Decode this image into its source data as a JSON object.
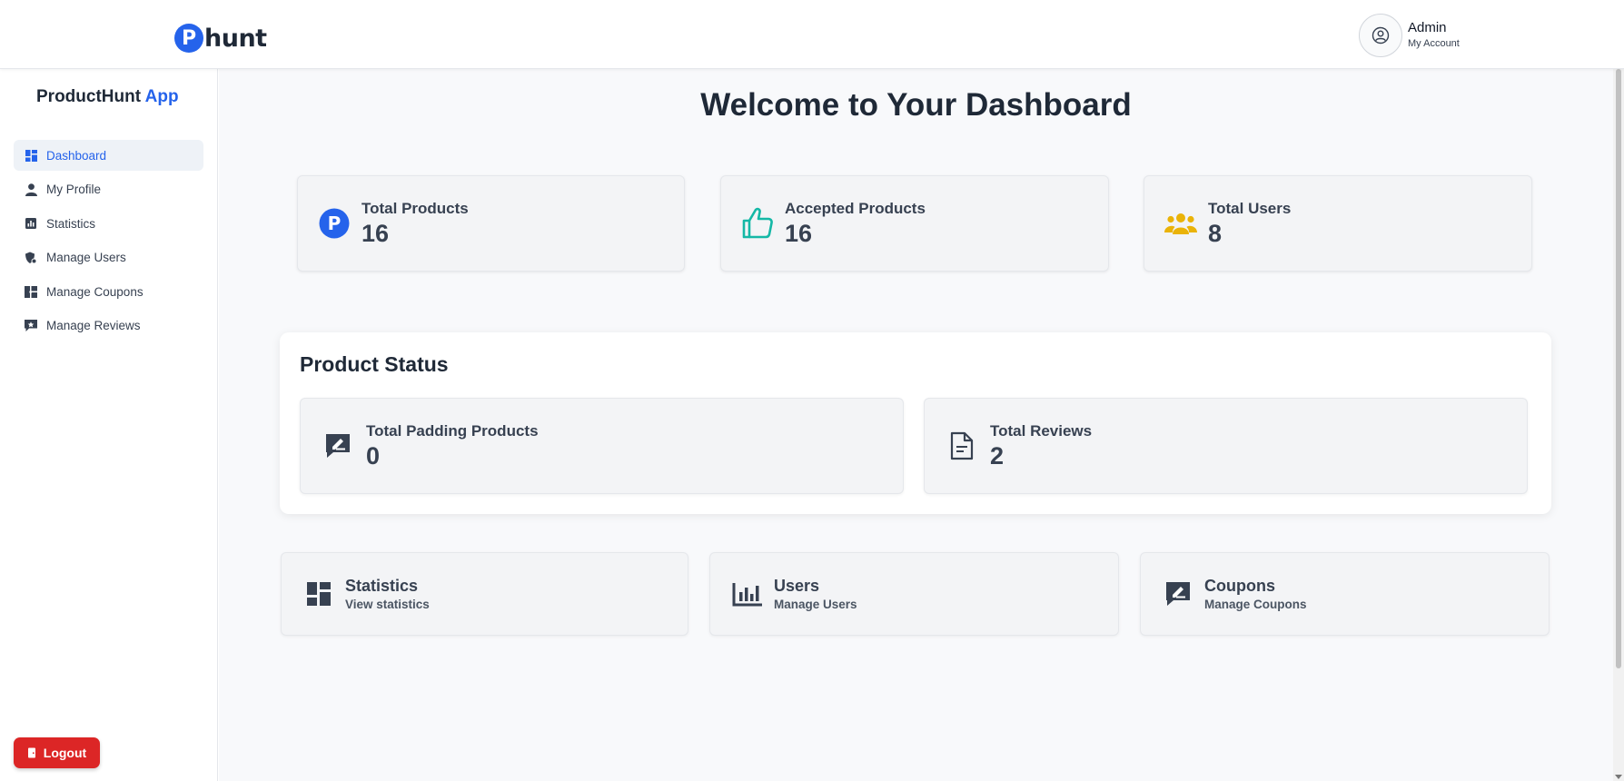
{
  "header": {
    "logo_letter": "P",
    "logo_text": "hunt",
    "account_name": "Admin",
    "account_sub": "My Account"
  },
  "sidebar": {
    "brand_main": "ProductHunt",
    "brand_accent": "App",
    "items": [
      {
        "label": "Dashboard",
        "icon": "dashboard-icon",
        "active": true
      },
      {
        "label": "My Profile",
        "icon": "user-icon",
        "active": false
      },
      {
        "label": "Statistics",
        "icon": "chart-icon",
        "active": false
      },
      {
        "label": "Manage Users",
        "icon": "user-gear-icon",
        "active": false
      },
      {
        "label": "Manage Coupons",
        "icon": "coupon-icon",
        "active": false
      },
      {
        "label": "Manage Reviews",
        "icon": "review-icon",
        "active": false
      }
    ],
    "logout_label": "Logout"
  },
  "main": {
    "title": "Welcome to Your Dashboard",
    "stats": [
      {
        "label": "Total Products",
        "value": "16",
        "icon": "product-hunt-icon",
        "color": "#2563eb"
      },
      {
        "label": "Accepted Products",
        "value": "16",
        "icon": "thumbs-up-icon",
        "color": "#14b8a6"
      },
      {
        "label": "Total Users",
        "value": "8",
        "icon": "users-icon",
        "color": "#eab308"
      }
    ],
    "status": {
      "title": "Product Status",
      "cards": [
        {
          "label": "Total Padding Products",
          "value": "0",
          "icon": "comment-edit-icon"
        },
        {
          "label": "Total Reviews",
          "value": "2",
          "icon": "document-icon"
        }
      ]
    },
    "links": [
      {
        "title": "Statistics",
        "sub": "View statistics",
        "icon": "dashboard-icon"
      },
      {
        "title": "Users",
        "sub": "Manage Users",
        "icon": "bar-chart-icon"
      },
      {
        "title": "Coupons",
        "sub": "Manage Coupons",
        "icon": "comment-edit-icon"
      }
    ]
  },
  "colors": {
    "accent": "#2563eb",
    "danger": "#dc2626",
    "teal": "#14b8a6",
    "gold": "#eab308"
  }
}
